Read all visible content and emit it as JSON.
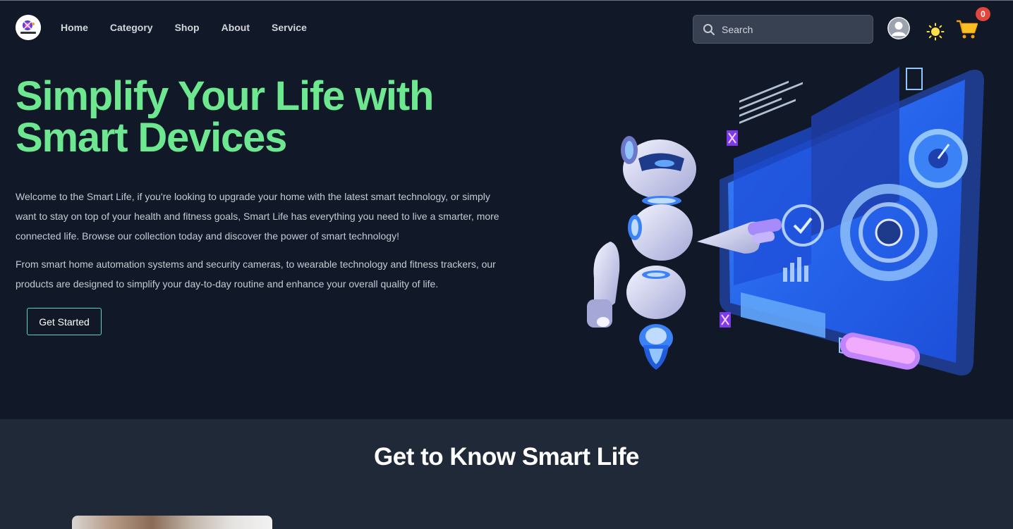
{
  "nav": {
    "logo_alt": "Smart Life",
    "links": [
      {
        "label": "Home"
      },
      {
        "label": "Category"
      },
      {
        "label": "Shop"
      },
      {
        "label": "About"
      },
      {
        "label": "Service"
      }
    ],
    "search_placeholder": "Search",
    "cart_count": "0"
  },
  "hero": {
    "title": "Simplify Your Life with Smart Devices",
    "paragraph1": "Welcome to the Smart Life, if you're looking to upgrade your home with the latest smart technology, or simply want to stay on top of your health and fitness goals, Smart Life has everything you need to live a smarter, more connected life. Browse our collection today and discover the power of smart technology!",
    "paragraph2": "From smart home automation systems and security cameras, to wearable technology and fitness trackers, our products are designed to simplify your day-to-day routine and enhance your overall quality of life.",
    "cta_label": "Get Started"
  },
  "about": {
    "title": "Get to Know Smart Life"
  },
  "colors": {
    "background": "#111827",
    "section_bg": "#1f2937",
    "accent_green": "#6ee791",
    "badge_red": "#e0463b"
  }
}
